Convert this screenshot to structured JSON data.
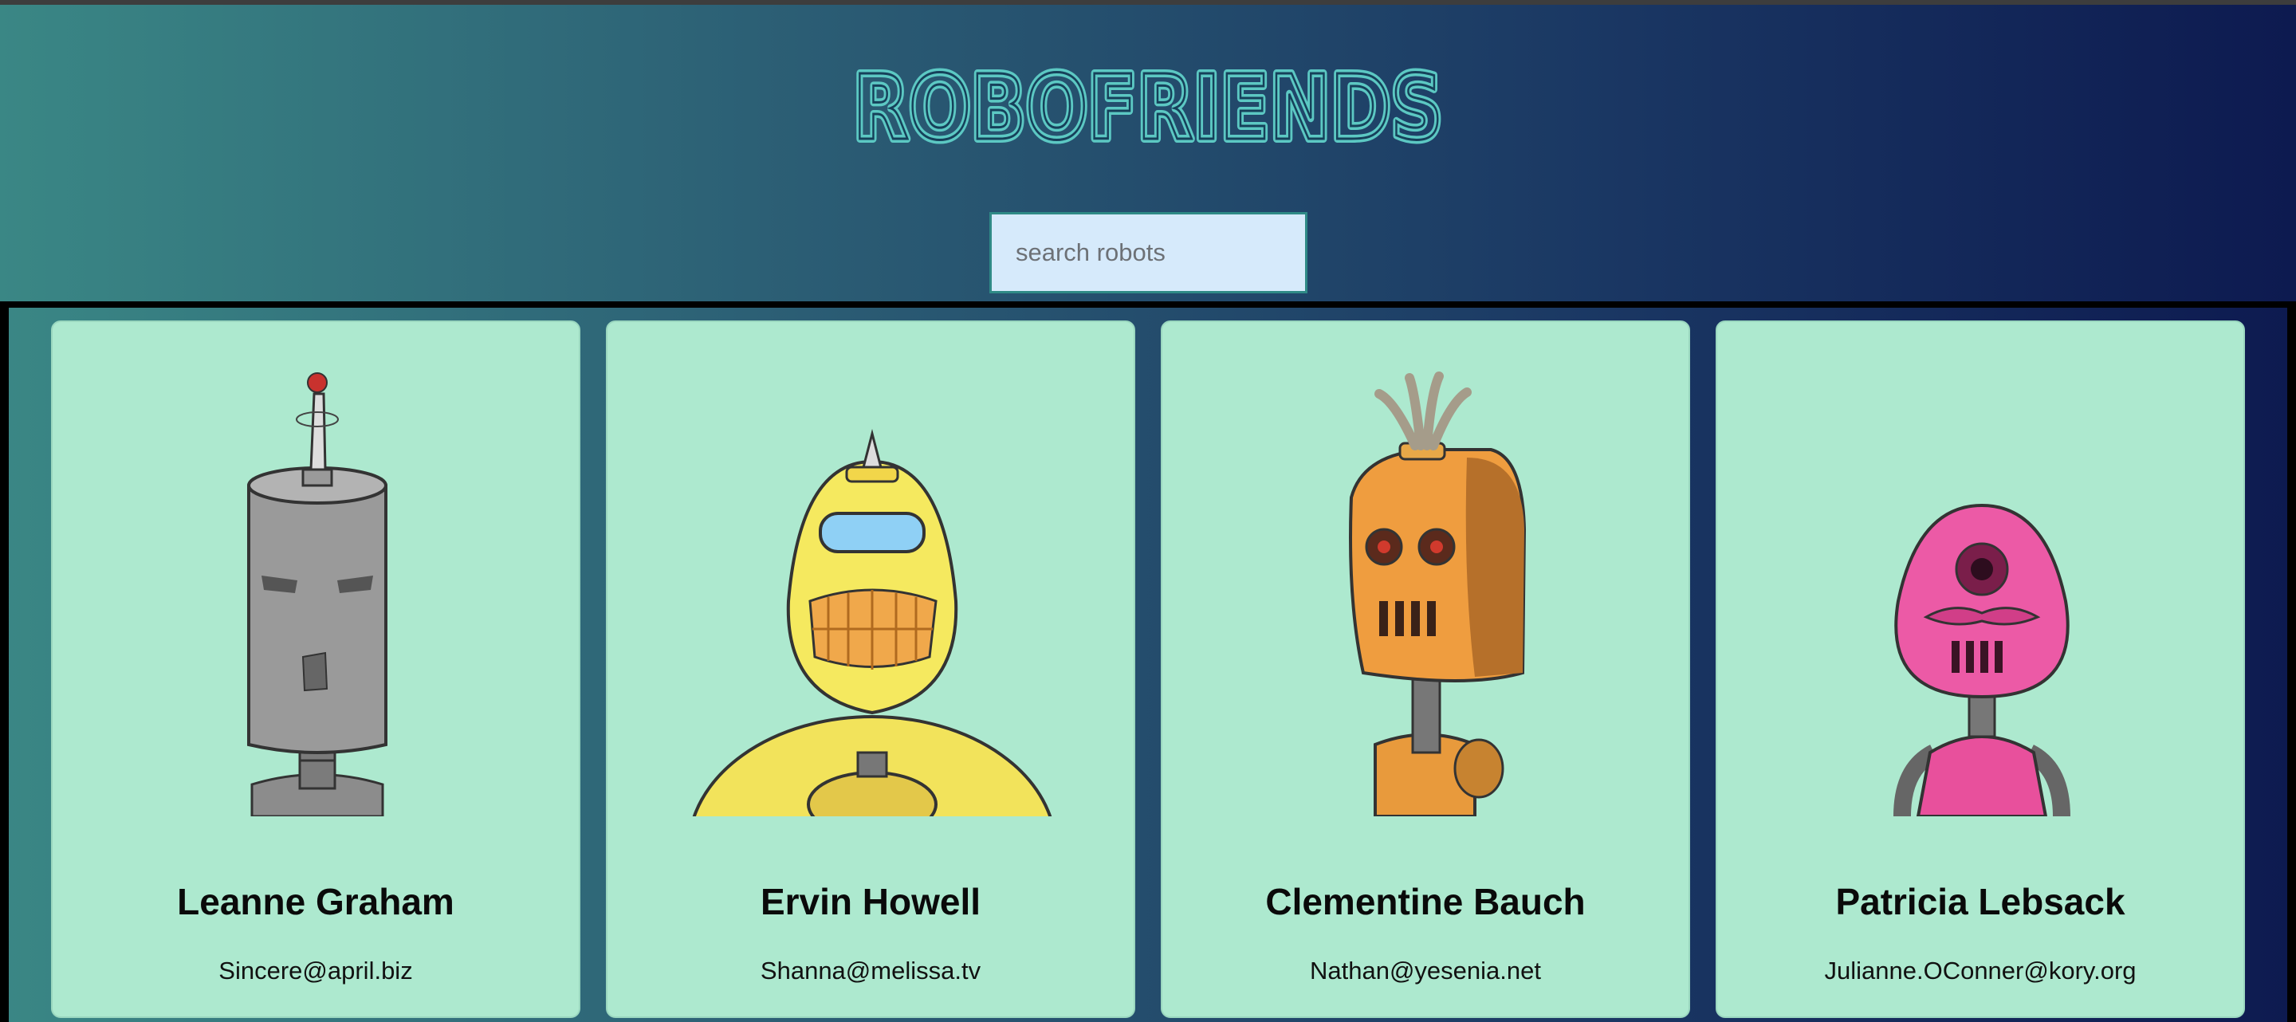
{
  "app": {
    "title": "ROBOFRIENDS"
  },
  "search": {
    "placeholder": "search robots",
    "value": ""
  },
  "robots": [
    {
      "name": "Leanne Graham",
      "email": "Sincere@april.biz",
      "icon": "grey-robot-icon"
    },
    {
      "name": "Ervin Howell",
      "email": "Shanna@melissa.tv",
      "icon": "yellow-robot-icon"
    },
    {
      "name": "Clementine Bauch",
      "email": "Nathan@yesenia.net",
      "icon": "orange-robot-icon"
    },
    {
      "name": "Patricia Lebsack",
      "email": "Julianne.OConner@kory.org",
      "icon": "pink-robot-icon"
    }
  ],
  "colors": {
    "logo": "#5cc8c3",
    "card_bg": "#ade9cf",
    "search_bg": "#d6eafb"
  }
}
